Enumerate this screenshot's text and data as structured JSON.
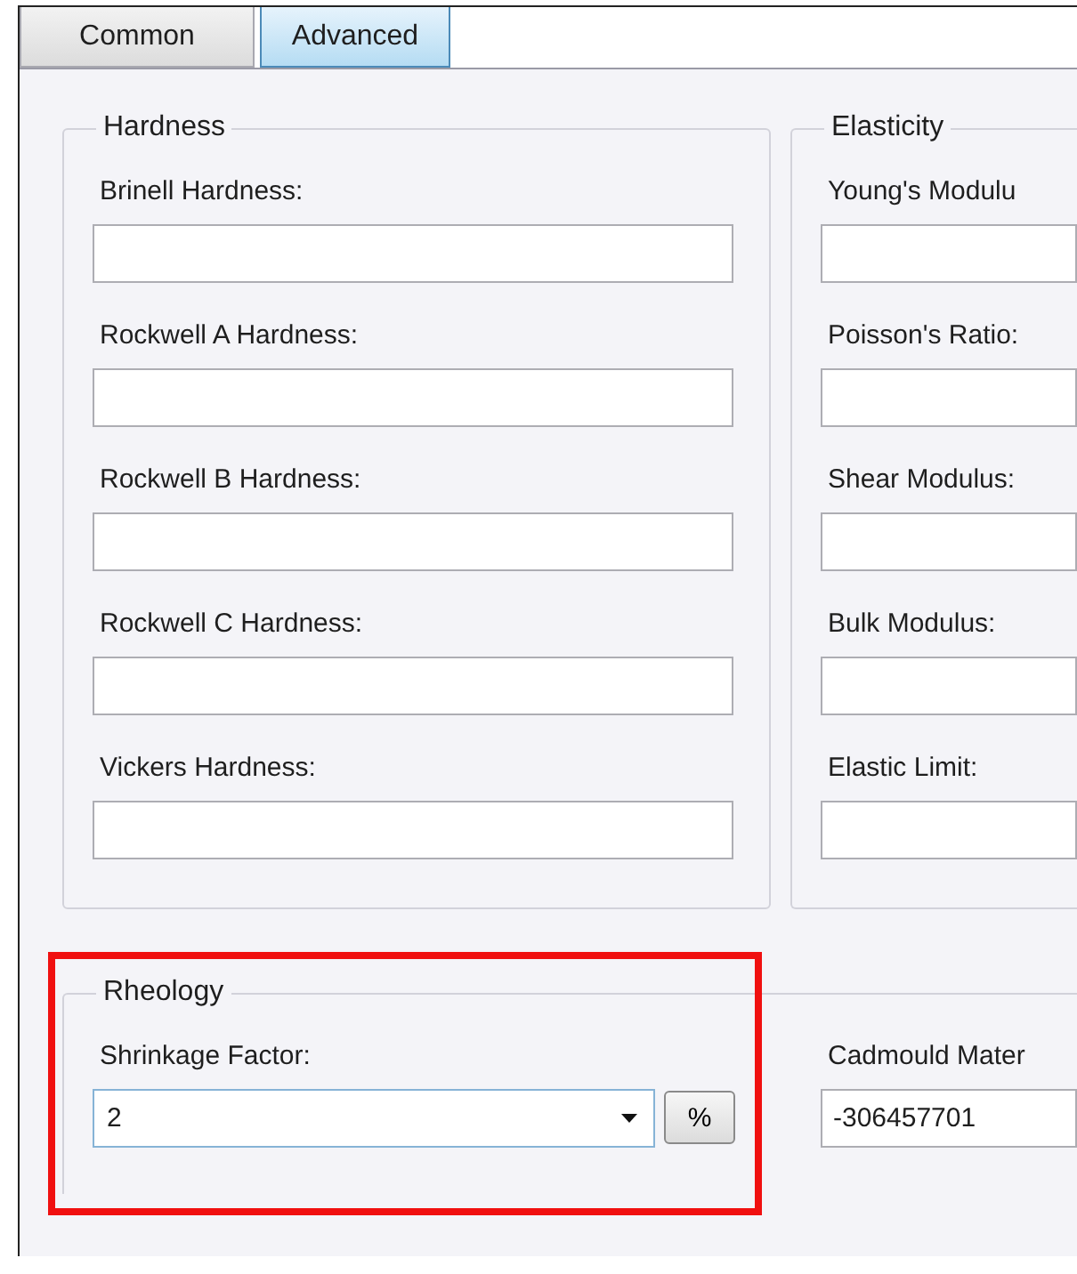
{
  "tabs": [
    {
      "label": "Common",
      "selected": false
    },
    {
      "label": "Advanced",
      "selected": true
    }
  ],
  "groups": [
    {
      "title": "Hardness",
      "fields": [
        {
          "label": "Brinell Hardness:"
        },
        {
          "label": "Rockwell A Hardness:"
        },
        {
          "label": "Rockwell B Hardness:"
        },
        {
          "label": "Rockwell C Hardness:"
        },
        {
          "label": "Vickers Hardness:"
        }
      ]
    },
    {
      "title": "Elasticity",
      "fields": [
        {
          "label": "Young's Modulu"
        },
        {
          "label": "Poisson's Ratio:"
        },
        {
          "label": "Shear Modulus:"
        },
        {
          "label": "Bulk Modulus:"
        },
        {
          "label": "Elastic Limit:"
        }
      ]
    }
  ],
  "rheology": {
    "title": "Rheology",
    "highlighted": true,
    "shrinkage": {
      "label": "Shrinkage Factor:",
      "value": "2",
      "unit": "%"
    },
    "cadmould": {
      "label": "Cadmould Mater",
      "value": "-306457701"
    }
  }
}
